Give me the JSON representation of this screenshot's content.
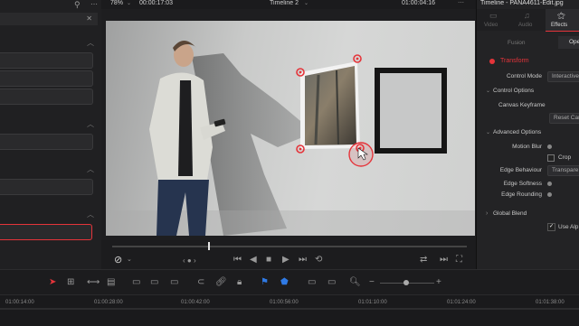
{
  "viewer": {
    "zoom": "78%",
    "timecode_left": "00:00:17:03",
    "timeline_name": "Timeline 2",
    "timecode_right": "01:00:04:16"
  },
  "inspector": {
    "title": "Timeline - PANA4611-Edit.jpg",
    "tabs": [
      {
        "label": "Video"
      },
      {
        "label": "Audio"
      },
      {
        "label": "Effects"
      }
    ],
    "subtabs": [
      {
        "label": "Fusion"
      },
      {
        "label": "Ope"
      }
    ],
    "transform_label": "Transform",
    "control_mode_label": "Control Mode",
    "control_mode_value": "Interactive",
    "control_options_label": "Control Options",
    "canvas_keyframe_label": "Canvas Keyframe",
    "reset_label": "Reset Can",
    "advanced_options_label": "Advanced Options",
    "motion_blur_label": "Motion Blur",
    "crop_label": "Crop",
    "edge_behaviour_label": "Edge Behaviour",
    "edge_behaviour_value": "Transpare",
    "edge_softness_label": "Edge Softness",
    "edge_rounding_label": "Edge Rounding",
    "global_blend_label": "Global Blend",
    "use_alpha_label": "Use Alp"
  },
  "ruler": {
    "ticks": [
      "01:00:14:00",
      "01:00:28:00",
      "01:00:42:00",
      "01:00:56:00",
      "01:01:10:00",
      "01:01:24:00",
      "01:01:38:00"
    ]
  },
  "colors": {
    "accent_red": "#e5343a",
    "playhead": "#e5e5e5",
    "icon_blue": "#2f7ae5"
  }
}
